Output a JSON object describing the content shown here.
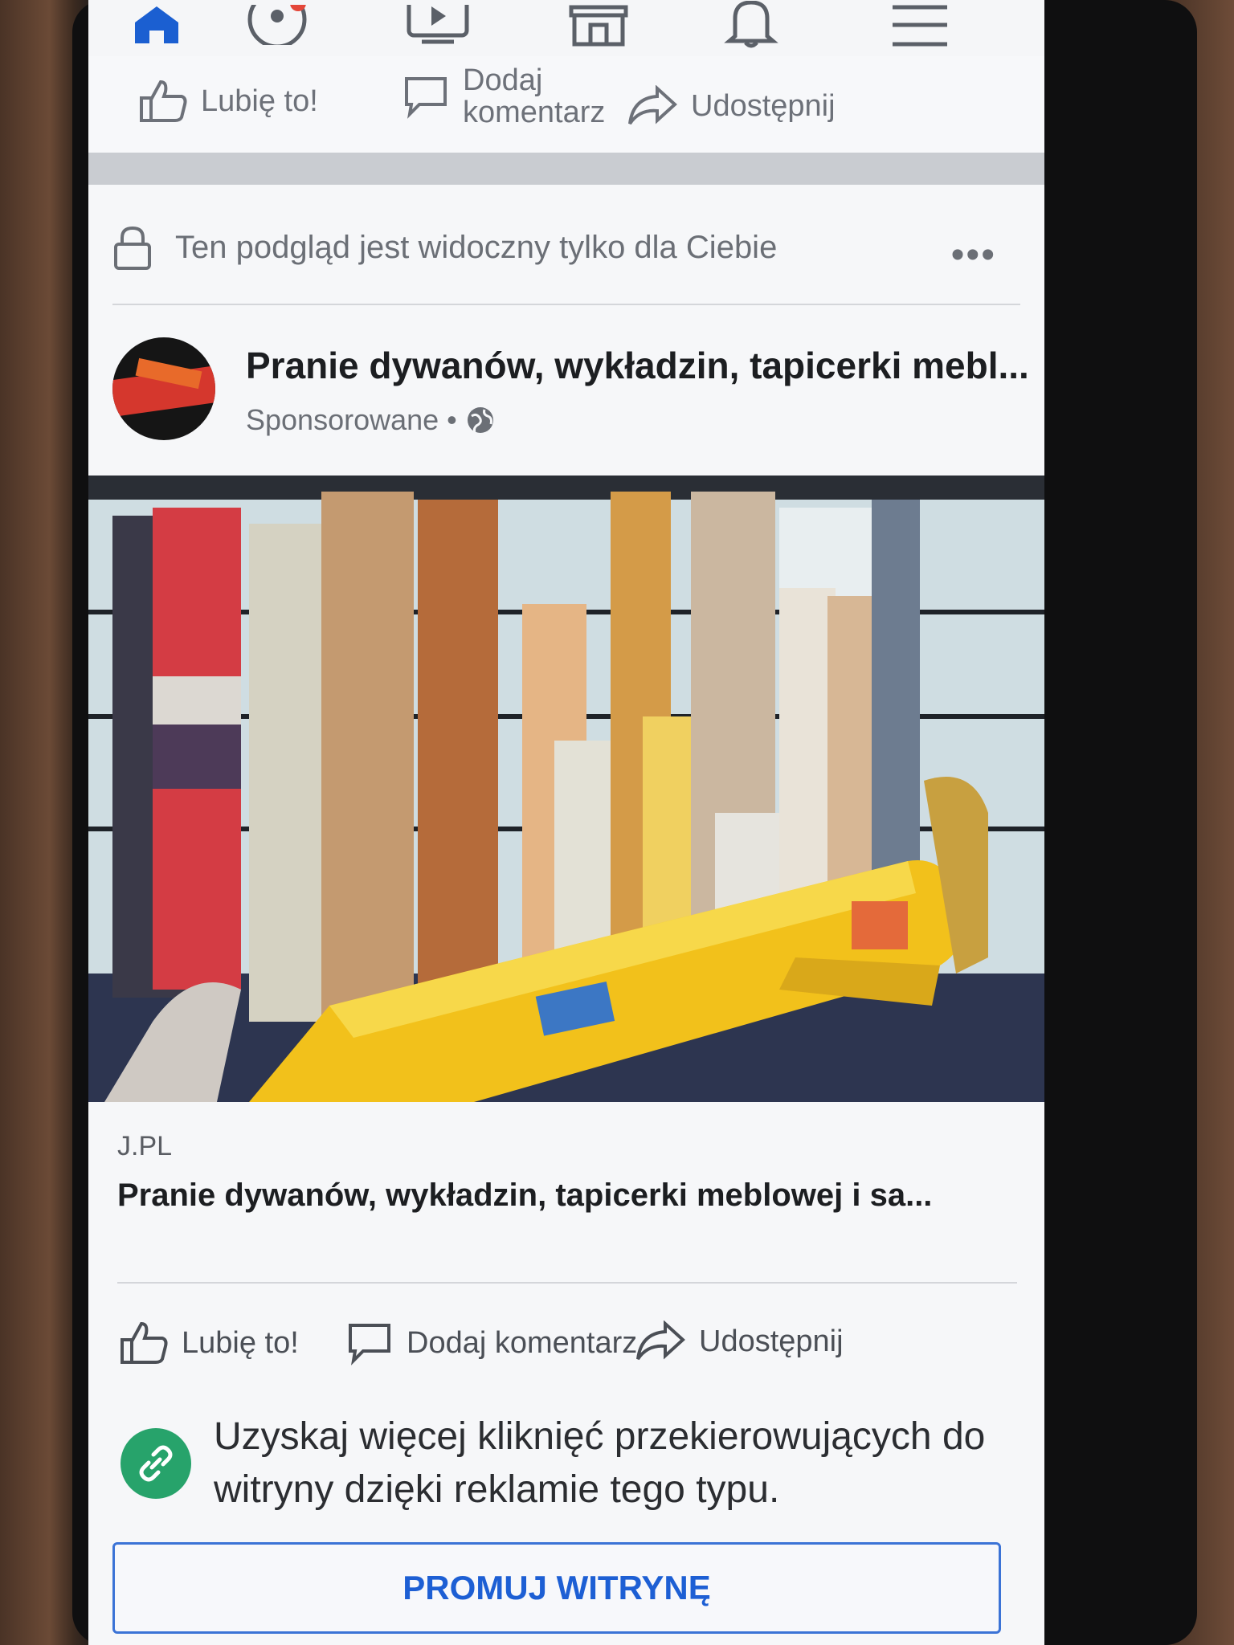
{
  "nav": {
    "items": [
      {
        "name": "home-icon",
        "glyph": "⌂",
        "active": true
      },
      {
        "name": "groups-icon",
        "glyph": "☺",
        "active": false
      },
      {
        "name": "watch-icon",
        "glyph": "▶",
        "active": false
      },
      {
        "name": "marketplace-icon",
        "glyph": "⌸",
        "active": false
      },
      {
        "name": "bell-icon",
        "glyph": "🔔",
        "active": false
      },
      {
        "name": "menu-icon",
        "glyph": "☰",
        "active": false
      }
    ]
  },
  "prev_post": {
    "like_label": "Lubię to!",
    "comment_label": "Dodaj komentarz",
    "share_label": "Udostępnij"
  },
  "post": {
    "notice": "Ten podgląd jest widoczny tylko dla Ciebie",
    "more": "•••",
    "page_name": "Pranie dywanów, wykładzin, tapicerki mebl...",
    "sponsored": "Sponsorowane",
    "dot": "•",
    "link_domain": "J.PL",
    "link_title": "Pranie dywanów, wykładzin, tapicerki meblowej i sa...",
    "like_label": "Lubię to!",
    "comment_label": "Dodaj komentarz",
    "share_label": "Udostępnij"
  },
  "promo": {
    "text": "Uzyskaj więcej kliknięć przekierowujących do witryny dzięki reklamie tego typu.",
    "button": "PROMUJ WITRYNĘ"
  },
  "colors": {
    "accent": "#1b5fd1",
    "promo_icon": "#27a36b"
  }
}
